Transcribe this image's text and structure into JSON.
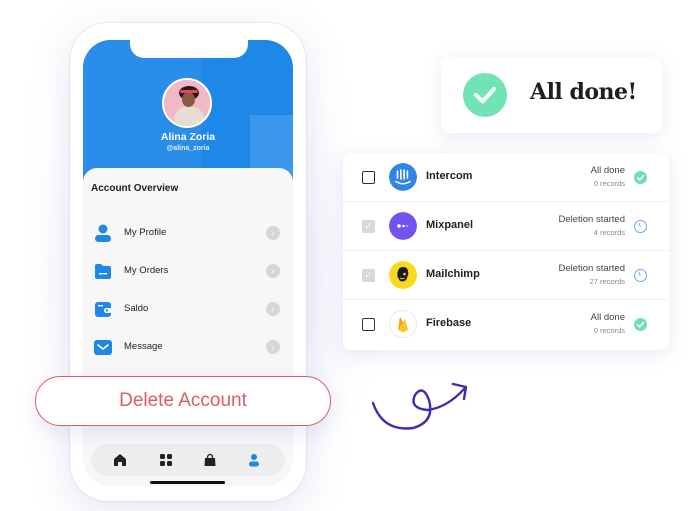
{
  "profile": {
    "name": "Alina Zoria",
    "handle": "@alina_zoria"
  },
  "account_overview": {
    "title": "Account Overview",
    "items": [
      {
        "label": "My Profile",
        "icon": "person-icon"
      },
      {
        "label": "My Orders",
        "icon": "folder-icon"
      },
      {
        "label": "Saldo",
        "icon": "wallet-icon"
      },
      {
        "label": "Message",
        "icon": "envelope-icon"
      }
    ]
  },
  "delete_button": {
    "label": "Delete Account"
  },
  "bottom_nav": {
    "items": [
      {
        "name": "home",
        "icon": "home-icon"
      },
      {
        "name": "apps",
        "icon": "grid-icon"
      },
      {
        "name": "shop",
        "icon": "shopping-bag-icon"
      },
      {
        "name": "account",
        "icon": "person-icon",
        "active": true
      }
    ]
  },
  "done_card": {
    "text": "All done!"
  },
  "integrations": [
    {
      "name": "Intercom",
      "status": "All done",
      "records": "0 records",
      "checked": false,
      "state": "done"
    },
    {
      "name": "Mixpanel",
      "status": "Deletion started",
      "records": "4 records",
      "checked": true,
      "state": "pending"
    },
    {
      "name": "Mailchimp",
      "status": "Deletion started",
      "records": "27 records",
      "checked": true,
      "state": "pending"
    },
    {
      "name": "Firebase",
      "status": "All done",
      "records": "0 records",
      "checked": false,
      "state": "done"
    }
  ],
  "colors": {
    "primary_blue": "#1e88e8",
    "delete_red": "#e05a5e",
    "success_green": "#72e3b4",
    "pending_blue": "#6aa8f0",
    "arrow_indigo": "#3a2fb0"
  }
}
